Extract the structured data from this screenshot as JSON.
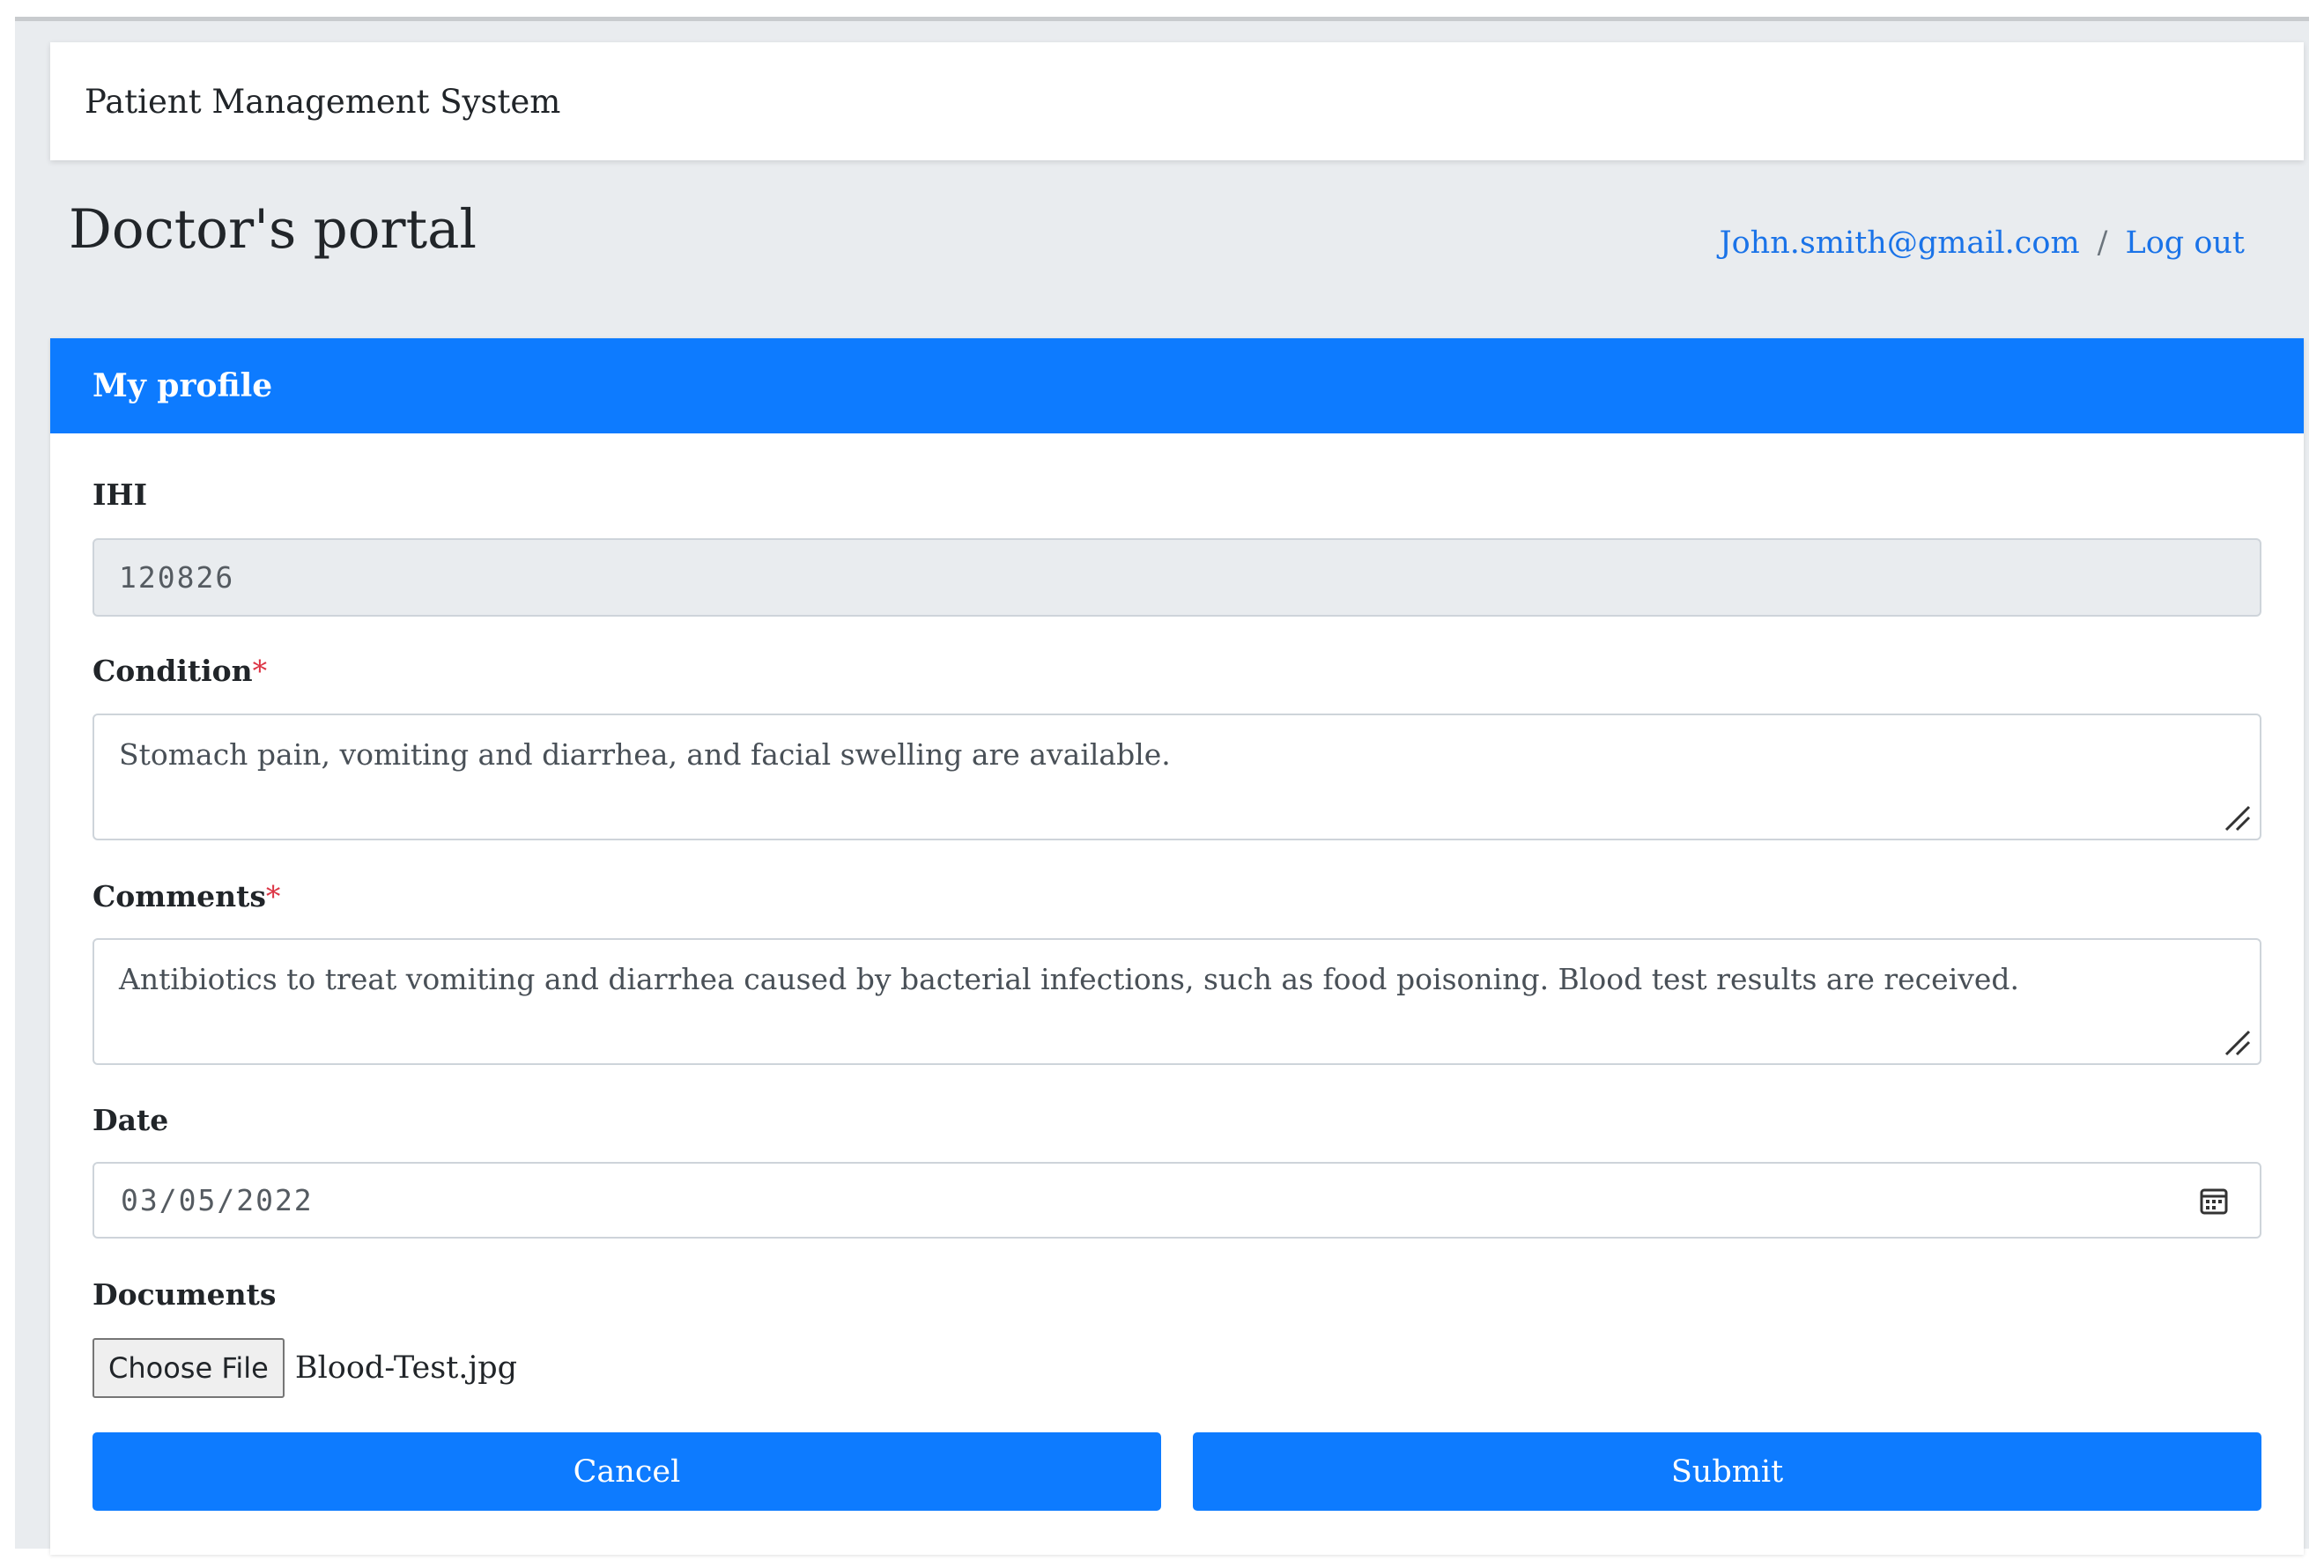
{
  "navbar": {
    "brand": "Patient Management System"
  },
  "header": {
    "title": "Doctor's portal",
    "user_email": "John.smith@gmail.com",
    "separator": "/",
    "logout_label": "Log out"
  },
  "card": {
    "title": "My profile"
  },
  "form": {
    "ihi": {
      "label": "IHI",
      "value": "120826"
    },
    "condition": {
      "label": "Condition",
      "required_mark": "*",
      "value": "Stomach pain, vomiting and diarrhea, and facial swelling are available."
    },
    "comments": {
      "label": "Comments",
      "required_mark": "*",
      "value": "Antibiotics to treat vomiting and diarrhea caused by bacterial infections, such as food poisoning. Blood test results are received."
    },
    "date": {
      "label": "Date",
      "value": "03/05/2022",
      "icon": "calendar-icon"
    },
    "documents": {
      "label": "Documents",
      "choose_label": "Choose File",
      "file_name": "Blood-Test.jpg"
    }
  },
  "actions": {
    "cancel_label": "Cancel",
    "submit_label": "Submit"
  },
  "colors": {
    "primary": "#0d7bff",
    "link": "#1a73e8",
    "required": "#dc3545",
    "background": "#e9ecef"
  }
}
